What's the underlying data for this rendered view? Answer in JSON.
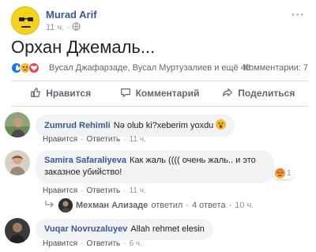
{
  "post": {
    "author": "Murad Arif",
    "time": "11 ч.",
    "text": "Орхан Джемаль...",
    "reactions_text": "Вусал Джафарзаде, Вусал Муртузалиев и ещё 48",
    "comments_count": "Комментарии: 7"
  },
  "actions": {
    "like": "Нравится",
    "comment": "Комментарий",
    "share": "Поделиться"
  },
  "comments": [
    {
      "name": "Zumrud Rehimli",
      "text": "Nə olub ki?xeberim yoxdu",
      "like": "Нравится",
      "reply": "Ответить",
      "time": "11 ч."
    },
    {
      "name": "Samira Safaraliyeva",
      "text": "Как жаль (((( очень жаль.. и это заказное убийство!",
      "like": "Нравится",
      "reply": "Ответить",
      "time": "11 ч.",
      "reaction_count": "1"
    },
    {
      "name": "Vuqar Novruzaluyev",
      "text": "Allah rehmet elesin",
      "like": "Нравится",
      "reply": "Ответить",
      "time": "6 ч."
    }
  ],
  "reply_summary": {
    "name": "Мехман Ализаде",
    "action": "ответил",
    "separator": "·",
    "count": "4 ответа",
    "time": "10 ч."
  },
  "colors": {
    "name_blue": "#385898",
    "meta_gray": "#90949c",
    "bubble_bg": "#f2f3f5"
  }
}
